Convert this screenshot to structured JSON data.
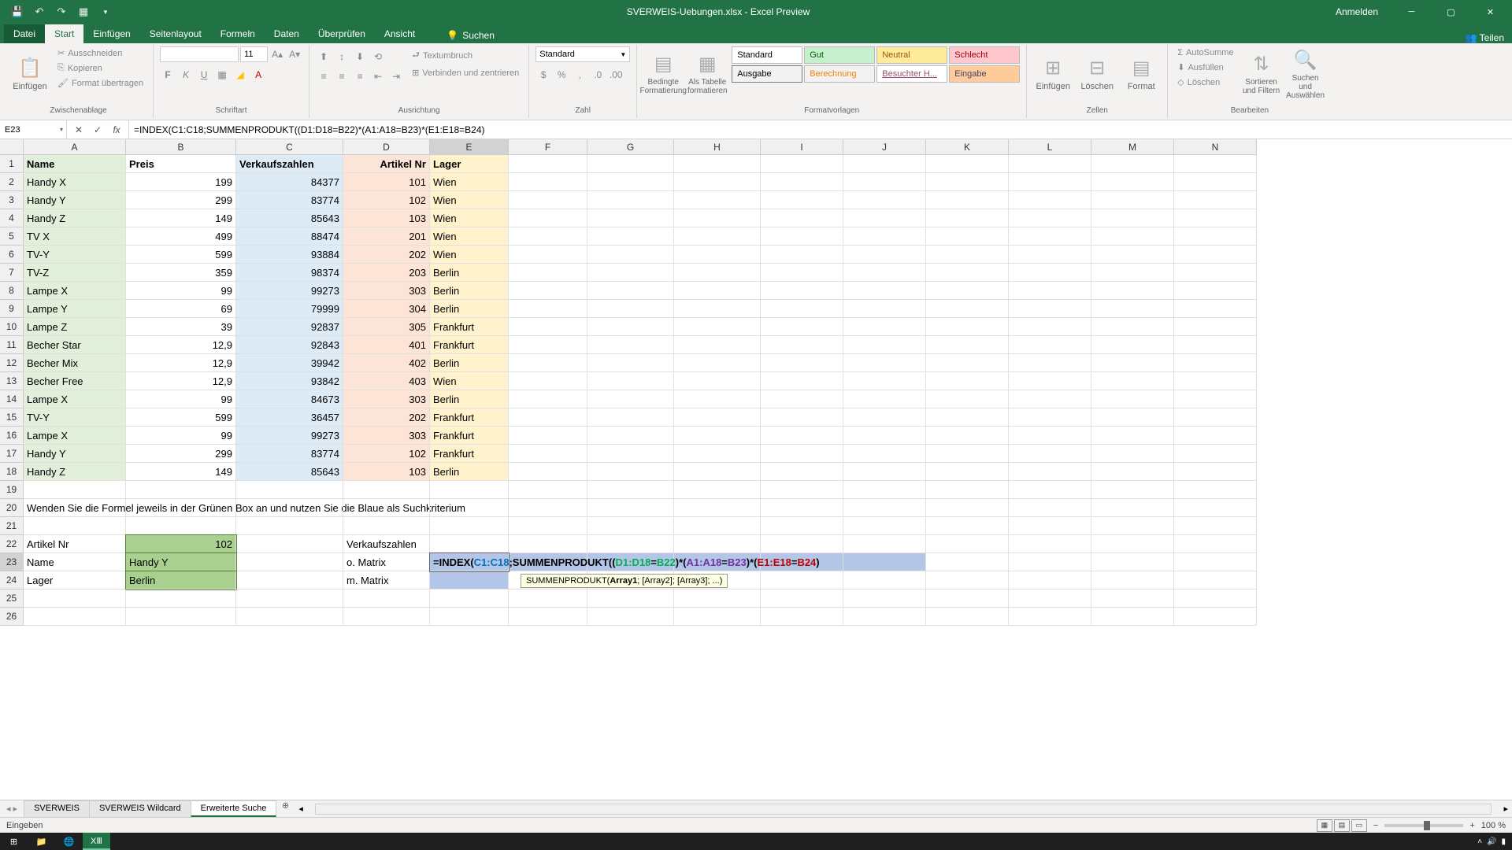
{
  "window": {
    "title": "SVERWEIS-Uebungen.xlsx - Excel Preview",
    "signin": "Anmelden"
  },
  "tabs": {
    "file": "Datei",
    "home": "Start",
    "insert": "Einfügen",
    "layout": "Seitenlayout",
    "formulas": "Formeln",
    "data": "Daten",
    "review": "Überprüfen",
    "view": "Ansicht",
    "search": "Suchen",
    "share": "Teilen"
  },
  "ribbon": {
    "clipboard": {
      "paste": "Einfügen",
      "cut": "Ausschneiden",
      "copy": "Kopieren",
      "format": "Format übertragen",
      "label": "Zwischenablage"
    },
    "font": {
      "size": "11",
      "label": "Schriftart"
    },
    "alignment": {
      "wrap": "Textumbruch",
      "merge": "Verbinden und zentrieren",
      "label": "Ausrichtung"
    },
    "number": {
      "format": "Standard",
      "label": "Zahl"
    },
    "styles": {
      "cond": "Bedingte Formatierung",
      "table": "Als Tabelle formatieren",
      "s1": "Standard",
      "s2": "Gut",
      "s3": "Neutral",
      "s4": "Schlecht",
      "s5": "Ausgabe",
      "s6": "Berechnung",
      "s7": "Besuchter H...",
      "s8": "Eingabe",
      "label": "Formatvorlagen"
    },
    "cells": {
      "insert": "Einfügen",
      "delete": "Löschen",
      "format": "Format",
      "label": "Zellen"
    },
    "editing": {
      "autosum": "AutoSumme",
      "fill": "Ausfüllen",
      "clear": "Löschen",
      "sort": "Sortieren und Filtern",
      "find": "Suchen und Auswählen",
      "label": "Bearbeiten"
    }
  },
  "namebox": "E23",
  "formula": "=INDEX(C1:C18;SUMMENPRODUKT((D1:D18=B22)*(A1:A18=B23)*(E1:E18=B24)",
  "formula_display": {
    "eq": "=",
    "fn1": "INDEX(",
    "r1": "C1:C18",
    "sep1": ";",
    "fn2": "SUMMENPRODUKT",
    "p1": "((",
    "r2": "D1:D18",
    "e1": "=",
    "r3": "B22",
    "p2": ")*(",
    "r4": "A1:A18",
    "e2": "=",
    "r5": "B23",
    "p3": ")*(",
    "r6": "E1:E18",
    "e3": "=",
    "r7": "B24",
    "p4": ")"
  },
  "tooltip": "SUMMENPRODUKT(Array1; [Array2]; [Array3]; ...)",
  "headers": {
    "A": "Name",
    "B": "Preis",
    "C": "Verkaufszahlen",
    "D": "Artikel Nr",
    "E": "Lager"
  },
  "data": [
    {
      "name": "Handy X",
      "preis": "199",
      "verkauf": "84377",
      "artnr": "101",
      "lager": "Wien"
    },
    {
      "name": "Handy Y",
      "preis": "299",
      "verkauf": "83774",
      "artnr": "102",
      "lager": "Wien"
    },
    {
      "name": "Handy Z",
      "preis": "149",
      "verkauf": "85643",
      "artnr": "103",
      "lager": "Wien"
    },
    {
      "name": "TV X",
      "preis": "499",
      "verkauf": "88474",
      "artnr": "201",
      "lager": "Wien"
    },
    {
      "name": "TV-Y",
      "preis": "599",
      "verkauf": "93884",
      "artnr": "202",
      "lager": "Wien"
    },
    {
      "name": "TV-Z",
      "preis": "359",
      "verkauf": "98374",
      "artnr": "203",
      "lager": "Berlin"
    },
    {
      "name": "Lampe X",
      "preis": "99",
      "verkauf": "99273",
      "artnr": "303",
      "lager": "Berlin"
    },
    {
      "name": "Lampe Y",
      "preis": "69",
      "verkauf": "79999",
      "artnr": "304",
      "lager": "Berlin"
    },
    {
      "name": "Lampe Z",
      "preis": "39",
      "verkauf": "92837",
      "artnr": "305",
      "lager": "Frankfurt"
    },
    {
      "name": "Becher Star",
      "preis": "12,9",
      "verkauf": "92843",
      "artnr": "401",
      "lager": "Frankfurt"
    },
    {
      "name": "Becher Mix",
      "preis": "12,9",
      "verkauf": "39942",
      "artnr": "402",
      "lager": "Berlin"
    },
    {
      "name": "Becher Free",
      "preis": "12,9",
      "verkauf": "93842",
      "artnr": "403",
      "lager": "Wien"
    },
    {
      "name": "Lampe X",
      "preis": "99",
      "verkauf": "84673",
      "artnr": "303",
      "lager": "Berlin"
    },
    {
      "name": "TV-Y",
      "preis": "599",
      "verkauf": "36457",
      "artnr": "202",
      "lager": "Frankfurt"
    },
    {
      "name": "Lampe X",
      "preis": "99",
      "verkauf": "99273",
      "artnr": "303",
      "lager": "Frankfurt"
    },
    {
      "name": "Handy Y",
      "preis": "299",
      "verkauf": "83774",
      "artnr": "102",
      "lager": "Frankfurt"
    },
    {
      "name": "Handy Z",
      "preis": "149",
      "verkauf": "85643",
      "artnr": "103",
      "lager": "Berlin"
    }
  ],
  "instruction": "Wenden Sie die Formel jeweils in der Grünen Box an und nutzen Sie die Blaue als Suchkriterium",
  "lookup": {
    "artnr_label": "Artikel Nr",
    "artnr_val": "102",
    "name_label": "Name",
    "name_val": "Handy Y",
    "lager_label": "Lager",
    "lager_val": "Berlin",
    "verkauf_label": "Verkaufszahlen",
    "omatrix": "o. Matrix",
    "mmatrix": "m. Matrix"
  },
  "sheets": {
    "s1": "SVERWEIS",
    "s2": "SVERWEIS Wildcard",
    "s3": "Erweiterte Suche"
  },
  "status": "Eingeben",
  "zoom": "100 %",
  "cols": [
    "A",
    "B",
    "C",
    "D",
    "E",
    "F",
    "G",
    "H",
    "I",
    "J",
    "K",
    "L",
    "M",
    "N"
  ]
}
